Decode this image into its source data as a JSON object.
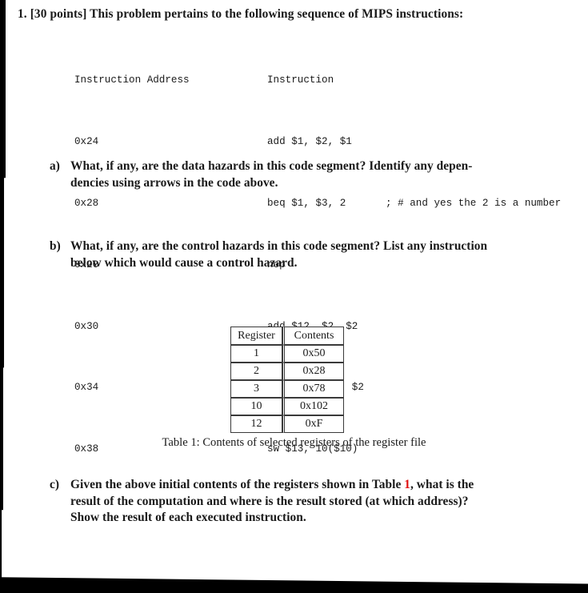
{
  "problem": {
    "number": "1.",
    "points_tag": "[30 points]",
    "statement": "This problem pertains to the following sequence of MIPS instructions:",
    "full_line": "1. [30 points] This problem pertains to the following sequence of MIPS instructions:"
  },
  "code_listing": {
    "headers": {
      "address": "Instruction Address",
      "instruction": "Instruction",
      "comment": ""
    },
    "rows": [
      {
        "address": "0x24",
        "instruction": "add $1, $2, $1",
        "comment": ""
      },
      {
        "address": "0x28",
        "instruction": "beq $1, $3, 2",
        "comment": "; # and yes the 2 is a number"
      },
      {
        "address": "0x2C",
        "instruction": "nop",
        "comment": ""
      },
      {
        "address": "0x30",
        "instruction": "add $12, $2, $2",
        "comment": ""
      },
      {
        "address": "0x34",
        "instruction": "add $13, $12, $2",
        "comment": ""
      },
      {
        "address": "0x38",
        "instruction": "sw $13, 10($10)",
        "comment": ""
      }
    ]
  },
  "parts": {
    "a": {
      "marker": "a)",
      "lines": [
        "What, if any, are the data hazards in this code segment? Identify any depen-",
        "dencies using arrows in the code above."
      ]
    },
    "b": {
      "marker": "b)",
      "lines": [
        "What, if any, are the control hazards in this code segment? List any instruction",
        "below which would cause a control hazard."
      ]
    },
    "c": {
      "marker": "c)",
      "line1_before_ref": "Given the above initial contents of the registers shown in Table ",
      "line1_ref": "1",
      "line1_after_ref": ", what is the",
      "line2": "result of the computation and where is the result stored (at which address)?",
      "line3": "Show the result of each executed instruction."
    }
  },
  "register_table": {
    "columns": [
      "Register",
      "Contents"
    ],
    "rows": [
      {
        "register": "1",
        "contents": "0x50"
      },
      {
        "register": "2",
        "contents": "0x28"
      },
      {
        "register": "3",
        "contents": "0x78"
      },
      {
        "register": "10",
        "contents": "0x102"
      },
      {
        "register": "12",
        "contents": "0xF"
      }
    ],
    "caption": "Table 1: Contents of selected registers of the register file"
  },
  "colors": {
    "text": "#1a1a1a",
    "reference_link": "#e01010",
    "table_rule": "#3a3a3a",
    "page_background": "#ffffff",
    "scan_edge": "#000000"
  }
}
